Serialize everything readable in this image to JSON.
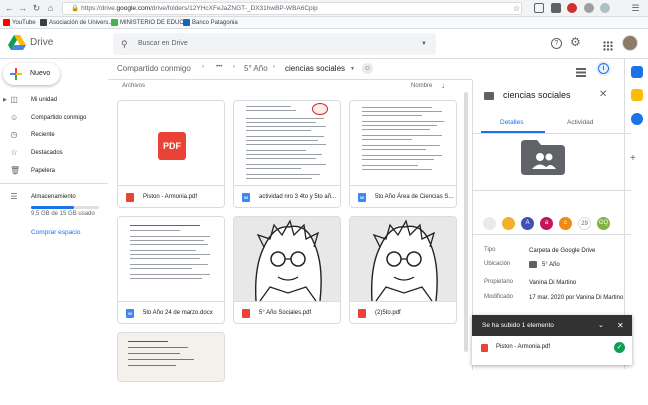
{
  "browser": {
    "url_prefix": "https://drive.",
    "url_domain": "google.com",
    "url_rest": "/drive/folders/12YHcXFeJaZNGT-_DX31hwBP-WBA6Cpip",
    "bookmarks": [
      "YouTube",
      "Asociación de Univers...",
      "MINISTERIO DE EDUC...",
      "Banco Patagonia"
    ]
  },
  "header": {
    "app_name": "Drive",
    "search_placeholder": "Buscar en Drive"
  },
  "sidebar": {
    "new_button": "Nuevo",
    "items": [
      {
        "label": "Mi unidad",
        "icon": "drive-icon"
      },
      {
        "label": "Compartido conmigo",
        "icon": "shared-icon"
      },
      {
        "label": "Reciente",
        "icon": "clock-icon"
      },
      {
        "label": "Destacados",
        "icon": "star-icon"
      },
      {
        "label": "Papelera",
        "icon": "trash-icon"
      }
    ],
    "storage_label": "Almacenamiento",
    "storage_used": "9,5 GB de 15 GB usado",
    "storage_fraction": 0.63,
    "buy_storage": "Comprar espacio"
  },
  "breadcrumb": {
    "root": "Compartido conmigo",
    "ellipsis": "•••",
    "parent": "5° Año",
    "current": "ciencias sociales"
  },
  "main": {
    "section_label": "Archivos",
    "sort_label": "Nombre",
    "files": [
      {
        "name": "Piston - Armonia.pdf",
        "type": "PDF"
      },
      {
        "name": "actividad nro 3 4to y 5to añ...",
        "type": "W"
      },
      {
        "name": "5to Año Área de Ciencias S...",
        "type": "W"
      },
      {
        "name": "5to Año 24 de marzo.docx",
        "type": "W"
      },
      {
        "name": "5° Año Sociales.pdf",
        "type": "PDF"
      },
      {
        "name": "(2)5to.pdf",
        "type": "PDF"
      }
    ],
    "pdf_badge": "PDF"
  },
  "details": {
    "title": "ciencias sociales",
    "tab_details": "Detalles",
    "tab_activity": "Actividad",
    "avatars": [
      {
        "label": "",
        "color": "#e8eaed"
      },
      {
        "label": "",
        "color": "#f6ae2d"
      },
      {
        "label": "A",
        "color": "#3f51b5"
      },
      {
        "label": "a",
        "color": "#c2185b"
      },
      {
        "label": "c",
        "color": "#ef8a17"
      },
      {
        "label": "29",
        "color": "#ffffff"
      },
      {
        "label": "GQ",
        "color": "#7cb342"
      }
    ],
    "props": [
      {
        "key": "Tipo",
        "value": "Carpeta de Google Drive"
      },
      {
        "key": "Ubicación",
        "value": "5° Año"
      },
      {
        "key": "Propietario",
        "value": "Vanina Di Martino"
      },
      {
        "key": "Modificado",
        "value": "17 mar. 2020 por Vanina Di Martino"
      }
    ]
  },
  "toast": {
    "title": "Se ha subido 1 elemento",
    "file": "Piston - Armonia.pdf"
  },
  "colors": {
    "accent": "#1a73e8",
    "pdf_red": "#ea4335",
    "doc_blue": "#4285f4",
    "success": "#0f9d58"
  }
}
